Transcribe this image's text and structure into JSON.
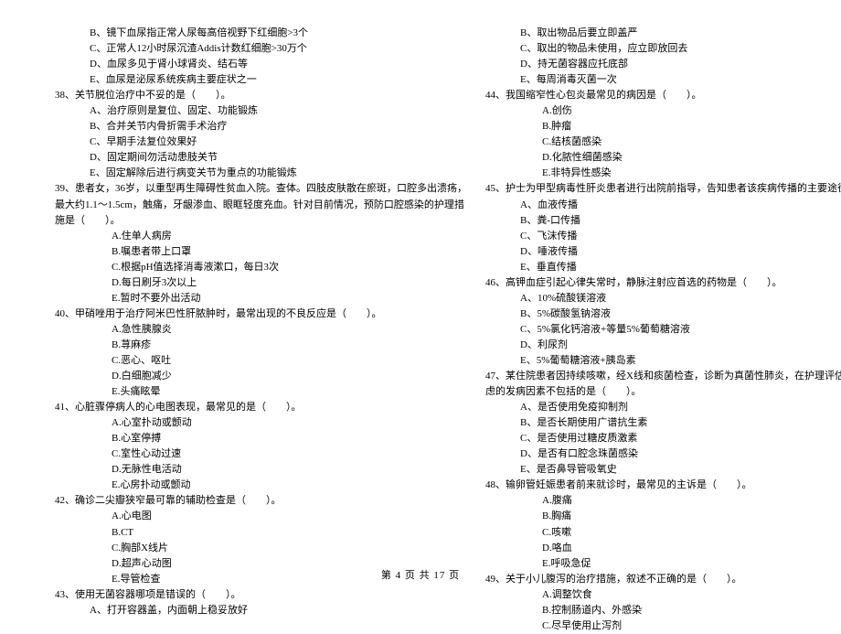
{
  "leftColumn": {
    "preLines": [
      "B、镜下血尿指正常人尿每高倍视野下红细胞>3个",
      "C、正常人12小时尿沉渣Addis计数红细胞>30万个",
      "D、血尿多见于肾小球肾炎、结石等",
      "E、血尿是泌尿系统疾病主要症状之一"
    ],
    "q38": {
      "stem": "38、关节脱位治疗中不妥的是（　　）。",
      "opts": [
        "A、治疗原则是复位、固定、功能锻炼",
        "B、合并关节内骨折需手术治疗",
        "C、早期手法复位效果好",
        "D、固定期间勿活动患肢关节",
        "E、固定解除后进行病变关节为重点的功能锻炼"
      ]
    },
    "q39": {
      "stemLines": [
        "39、患者女，36岁，以重型再生障碍性贫血入院。查体。四肢皮肤散在瘀斑，口腔多出溃疡，",
        "最大约1.1～1.5cm，触痛，牙龈渗血、眼眶轻度充血。针对目前情况，预防口腔感染的护理措",
        "施是（　　）。"
      ],
      "opts": [
        "A.住单人病房",
        "B.嘱患者带上口罩",
        "C.根据pH值选择消毒液漱口，每日3次",
        "D.每日刷牙3次以上",
        "E.暂时不要外出活动"
      ]
    },
    "q40": {
      "stem": "40、甲硝唑用于治疗阿米巴性肝脓肿时，最常出现的不良反应是（　　）。",
      "opts": [
        "A.急性胰腺炎",
        "B.荨麻疹",
        "C.恶心、呕吐",
        "D.白细胞减少",
        "E.头痛眩晕"
      ]
    },
    "q41": {
      "stem": "41、心脏骤停病人的心电图表现，最常见的是（　　）。",
      "opts": [
        "A.心室扑动或颤动",
        "B.心室停搏",
        "C.室性心动过速",
        "D.无脉性电活动",
        "E.心房扑动或颤动"
      ]
    },
    "blank1": "",
    "q42": {
      "stem": "42、确诊二尖瓣狭窄最可靠的辅助检查是（　　）。",
      "opts": [
        "A.心电图",
        "B.CT",
        "C.胸部X线片",
        "D.超声心动图",
        "E.导管检查"
      ]
    },
    "q43": {
      "stem": "43、使用无菌容器哪项是错误的（　　）。",
      "opts": [
        "A、打开容器盖，内面朝上稳妥放好"
      ]
    }
  },
  "rightColumn": {
    "preLines": [
      "B、取出物品后要立即盖严",
      "C、取出的物品未使用，应立即放回去",
      "D、持无菌容器应托底部",
      "E、每周消毒灭菌一次"
    ],
    "q44": {
      "stem": "44、我国缩窄性心包炎最常见的病因是（　　）。",
      "opts": [
        "A.创伤",
        "B.肿瘤",
        "C.结核菌感染",
        "D.化脓性细菌感染",
        "E.非特异性感染"
      ]
    },
    "q45": {
      "stemLines": [
        "45、护士为甲型病毒性肝炎患者进行出院前指导，告知患者该疾病传播的主要途径是（　　）。"
      ],
      "opts": [
        "A、血液传播",
        "B、粪-口传播",
        "C、飞沫传播",
        "D、唾液传播",
        "E、垂直传播"
      ]
    },
    "q46": {
      "stem": "46、高钾血症引起心律失常时，静脉注射应首选的药物是（　　）。",
      "opts": [
        "A、10%硫酸镁溶液",
        "B、5%碳酸氢钠溶液",
        "C、5%氯化钙溶液+等量5%葡萄糖溶液",
        "D、利尿剂",
        "E、5%葡萄糖溶液+胰岛素"
      ]
    },
    "q47": {
      "stemLines": [
        "47、某住院患者因持续咳嗽，经X线和痰菌检查，诊断为真菌性肺炎，在护理评估时，需要考",
        "虑的发病因素不包括的是（　　）。"
      ],
      "opts": [
        "A、是否使用免疫抑制剂",
        "B、是否长期使用广谱抗生素",
        "C、是否使用过糖皮质激素",
        "D、是否有口腔念珠菌感染",
        "E、是否鼻导管吸氧史"
      ]
    },
    "q48": {
      "stem": "48、输卵管妊娠患者前来就诊时，最常见的主诉是（　　）。",
      "opts": [
        "A.腹痛",
        "B.胸痛",
        "C.咳嗽",
        "D.咯血",
        "E.呼吸急促"
      ]
    },
    "q49": {
      "stem": "49、关于小儿腹泻的治疗措施，叙述不正确的是（　　）。",
      "opts": [
        "A.调整饮食",
        "B.控制肠道内、外感染",
        "C.尽早使用止泻剂"
      ]
    }
  },
  "footer": "第 4 页 共 17 页"
}
